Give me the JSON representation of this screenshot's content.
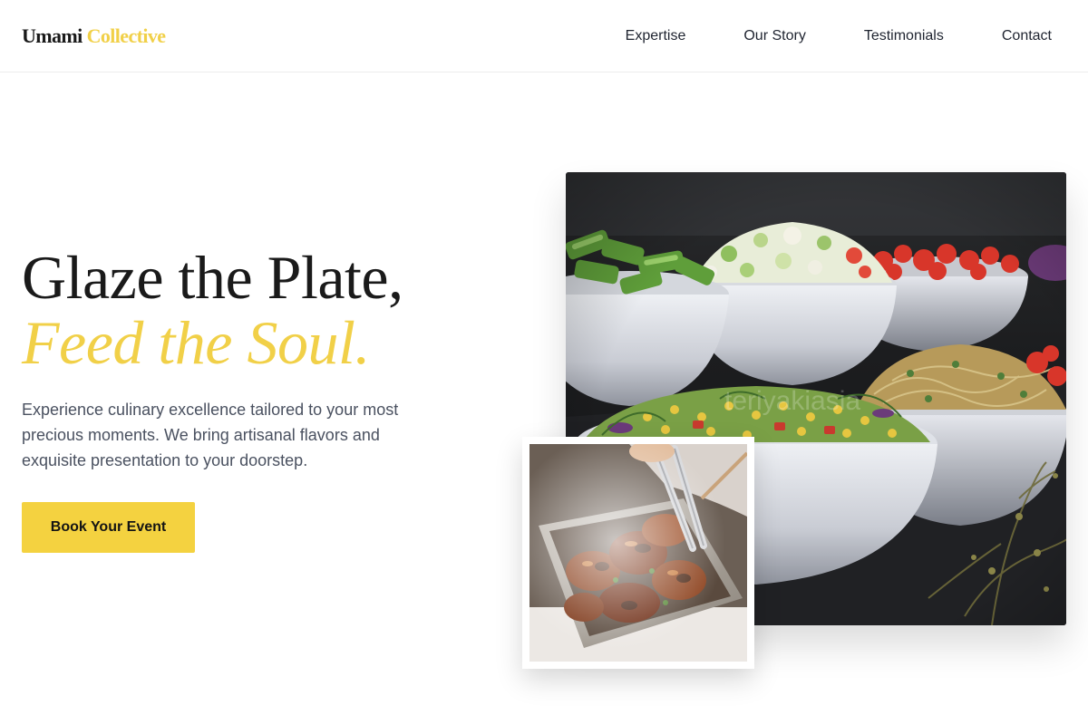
{
  "brand": {
    "name_part1": "Umami",
    "name_part2": "Collective",
    "accent": "#f1d048"
  },
  "nav": {
    "items": [
      {
        "label": "Expertise"
      },
      {
        "label": "Our Story"
      },
      {
        "label": "Testimonials"
      },
      {
        "label": "Contact"
      }
    ]
  },
  "hero": {
    "title_line1": "Glaze the Plate,",
    "title_line2": "Feed the Soul.",
    "subtitle": "Experience culinary excellence tailored to your most precious moments. We bring artisanal flavors and exquisite presentation to your doorstep.",
    "cta_label": "Book Your Event",
    "cta_color": "#f4d240"
  },
  "images": {
    "main_watermark": "teriyakiasia",
    "main_icon": "salad-bowls-photo",
    "inset_icon": "grilled-meat-photo"
  }
}
